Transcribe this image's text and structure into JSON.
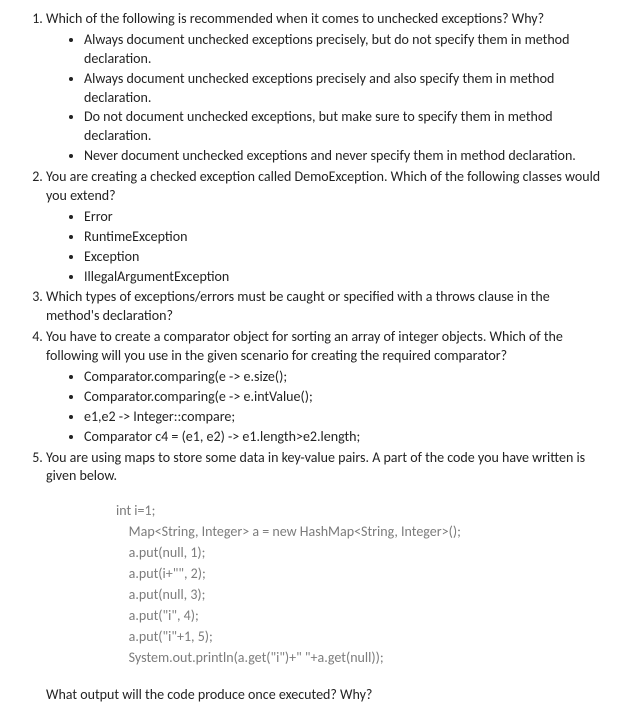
{
  "questions": [
    {
      "text": "Which of the following is recommended when it comes to unchecked exceptions? Why?",
      "options": [
        "Always document unchecked exceptions precisely, but do not specify them in method declaration.",
        "Always document unchecked exceptions precisely and also specify them in method declaration.",
        "Do not document unchecked exceptions, but make sure to specify them in method declaration.",
        "Never document unchecked exceptions and never specify them in method declaration."
      ]
    },
    {
      "text": "You are creating a checked exception called DemoException. Which of the following classes would you extend?",
      "options": [
        "Error",
        "RuntimeException",
        "Exception",
        "IllegalArgumentException"
      ]
    },
    {
      "text": "Which types of exceptions/errors must be caught or specified with a throws clause in the method's declaration?"
    },
    {
      "text": "You have to create a comparator object for sorting an array of integer objects. Which of the following will you use in the given scenario for creating the required comparator?",
      "options": [
        "Comparator.comparing(e -> e.size();",
        "Comparator.comparing(e -> e.intValue();",
        "e1,e2 -> Integer::compare;",
        "Comparator c4 = (e1, e2) -> e1.length>e2.length;"
      ]
    },
    {
      "text": "You are using maps to store some data in key-value pairs. A part of the code you have written is given below.",
      "code": "int i=1;\n    Map<String, Integer> a = new HashMap<String, Integer>();\n    a.put(null, 1);\n    a.put(i+\"\", 2);\n    a.put(null, 3);\n    a.put(\"i\", 4);\n    a.put(\"i\"+1, 5);\n    System.out.println(a.get(\"i\")+\" \"+a.get(null));",
      "follow": "What output will the code produce once executed? Why?"
    }
  ]
}
